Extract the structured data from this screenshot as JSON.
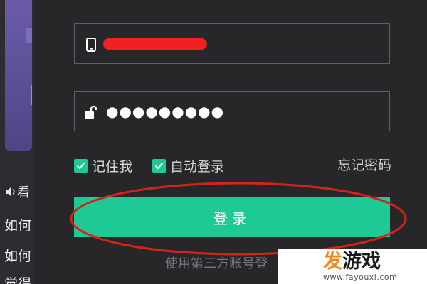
{
  "background": {
    "left_text_lines": [
      "如何",
      "如何",
      "觉得"
    ],
    "speaker_text": "看"
  },
  "login": {
    "phone_field": {
      "icon": "mobile-phone-icon",
      "redaction_color": "#f22020"
    },
    "password_field": {
      "icon": "unlock-icon",
      "masked_value": "●●●●●●●●●"
    },
    "remember_me": {
      "label": "记住我",
      "checked": true
    },
    "auto_login": {
      "label": "自动登录",
      "checked": true
    },
    "forgot_password": "忘记密码",
    "login_button": "登录",
    "third_party_text": "使用第三方账号登"
  },
  "colors": {
    "accent": "#1ec996",
    "annotation": "#d42418",
    "dialog_bg": "#27272a",
    "field_border": "#5e5e63"
  },
  "watermark": {
    "logo_char": "发",
    "logo_rest": "游戏",
    "url": "www.fayouxi.com"
  }
}
